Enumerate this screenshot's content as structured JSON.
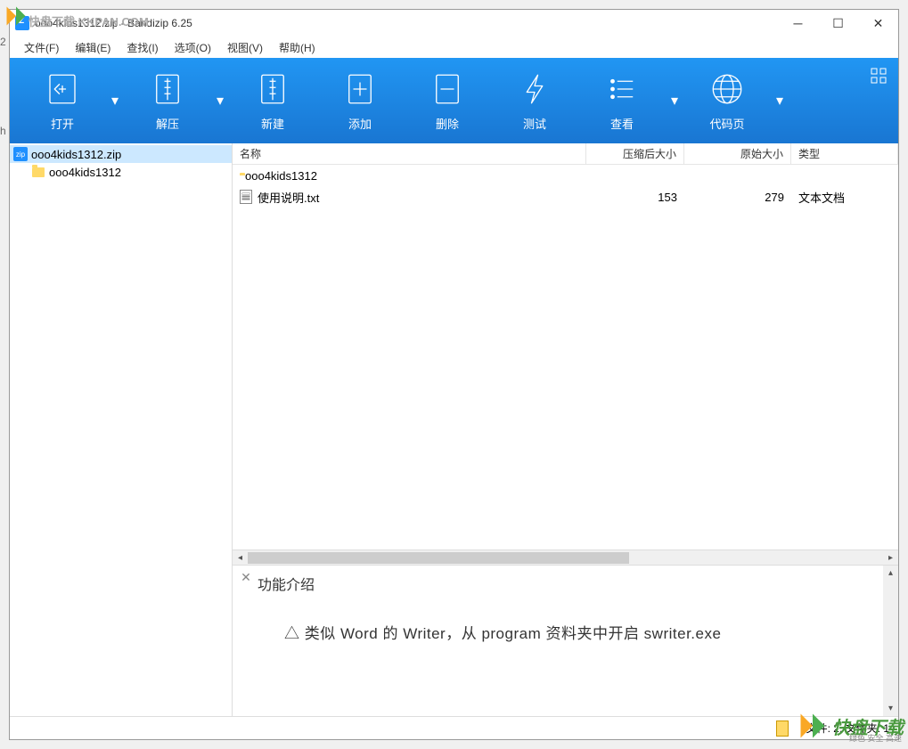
{
  "window": {
    "title": "ooo4kids1312.zip - Bandizip 6.25"
  },
  "watermark": {
    "top_left": "快盘下载 KKPAN.COM",
    "bottom_right_main": "快盘下载",
    "bottom_right_sub": "绿色 安全 高速"
  },
  "menu": {
    "file": "文件(F)",
    "edit": "编辑(E)",
    "find": "查找(I)",
    "options": "选项(O)",
    "view": "视图(V)",
    "help": "帮助(H)"
  },
  "toolbar": {
    "open": "打开",
    "extract": "解压",
    "new": "新建",
    "add": "添加",
    "delete": "删除",
    "test": "测试",
    "view": "查看",
    "codepage": "代码页"
  },
  "tree": {
    "root": "ooo4kids1312.zip",
    "child": "ooo4kids1312"
  },
  "columns": {
    "name": "名称",
    "compressed": "压缩后大小",
    "original": "原始大小",
    "type": "类型"
  },
  "files": [
    {
      "name": "ooo4kids1312",
      "compressed": "",
      "original": "",
      "type": "",
      "icon": "folder"
    },
    {
      "name": "使用说明.txt",
      "compressed": "153",
      "original": "279",
      "type": "文本文档",
      "icon": "txt"
    }
  ],
  "preview": {
    "title": "功能介绍",
    "body": "△ 类似 Word 的 Writer，从 program 资料夹中开启 swriter.exe"
  },
  "status": {
    "text": "文件: 2, 文件夹: 1"
  }
}
